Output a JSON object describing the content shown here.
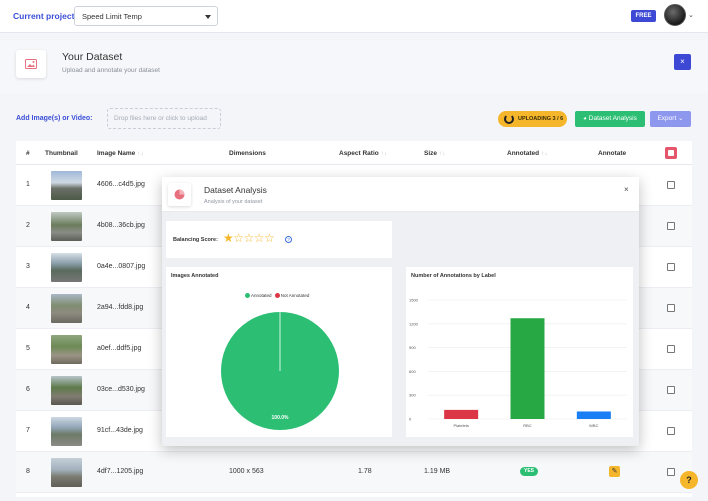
{
  "topbar": {
    "project_label": "Current project:",
    "project_value": "Speed Limit Temp",
    "plan_badge": "FREE"
  },
  "header": {
    "title": "Your Dataset",
    "subtitle": "Upload and annotate your dataset",
    "close": "×"
  },
  "actions": {
    "add_label": "Add Image(s) or Video:",
    "dropzone": "Drop files here or click to upload",
    "uploading": "UPLOADING 3 / 6",
    "analysis": "Dataset Analysis",
    "export": "Export ⌄"
  },
  "table": {
    "headers": {
      "num": "#",
      "thumb": "Thumbnail",
      "name": "Image Name",
      "dim": "Dimensions",
      "ratio": "Aspect Ratio",
      "size": "Size",
      "annotated": "Annotated",
      "annotate": "Annotate"
    },
    "sort_icon": "↑↓",
    "rows": [
      {
        "num": "1",
        "name": "4606...c4d5.jpg"
      },
      {
        "num": "2",
        "name": "4b08...36cb.jpg"
      },
      {
        "num": "3",
        "name": "0a4e...0807.jpg"
      },
      {
        "num": "4",
        "name": "2a94...fdd8.jpg"
      },
      {
        "num": "5",
        "name": "a0ef...ddf5.jpg"
      },
      {
        "num": "6",
        "name": "03ce...d530.jpg"
      },
      {
        "num": "7",
        "name": "91cf...43de.jpg"
      },
      {
        "num": "8",
        "name": "4df7...1205.jpg",
        "dim": "1000 x 563",
        "ratio": "1.78",
        "size": "1.19 MB",
        "annotated": "YES"
      }
    ]
  },
  "modal": {
    "title": "Dataset Analysis",
    "subtitle": "Analysis of your dataset",
    "close": "×",
    "balancing_label": "Balancing Score:",
    "stars": "★☆☆☆☆",
    "balancing_stars": 1,
    "info": "?"
  },
  "help": "?",
  "colors": {
    "accent": "#3d49d4",
    "green": "#2cbf74",
    "red": "#dc3545",
    "blue": "#1a7ef5",
    "yellow": "#f5b62c"
  },
  "chart_data": [
    {
      "type": "pie",
      "title": "Images Annotated",
      "labels": [
        "Annotated",
        "Not Annotated"
      ],
      "values": [
        100,
        0
      ],
      "colors": [
        "#2cbf74",
        "#dc3545"
      ],
      "data_label": "100.0%",
      "legend": "top"
    },
    {
      "type": "bar",
      "title": "Number of Annotations by Label",
      "categories": [
        "Platelets",
        "RBC",
        "WBC"
      ],
      "values": [
        115,
        1270,
        95
      ],
      "colors": [
        "#dc3545",
        "#28a745",
        "#1a7ef5"
      ],
      "ylim": [
        0,
        1500
      ],
      "yticks": [
        "0",
        "300",
        "600",
        "900",
        "1200",
        "1500"
      ],
      "grid": true,
      "legend": "none"
    }
  ]
}
